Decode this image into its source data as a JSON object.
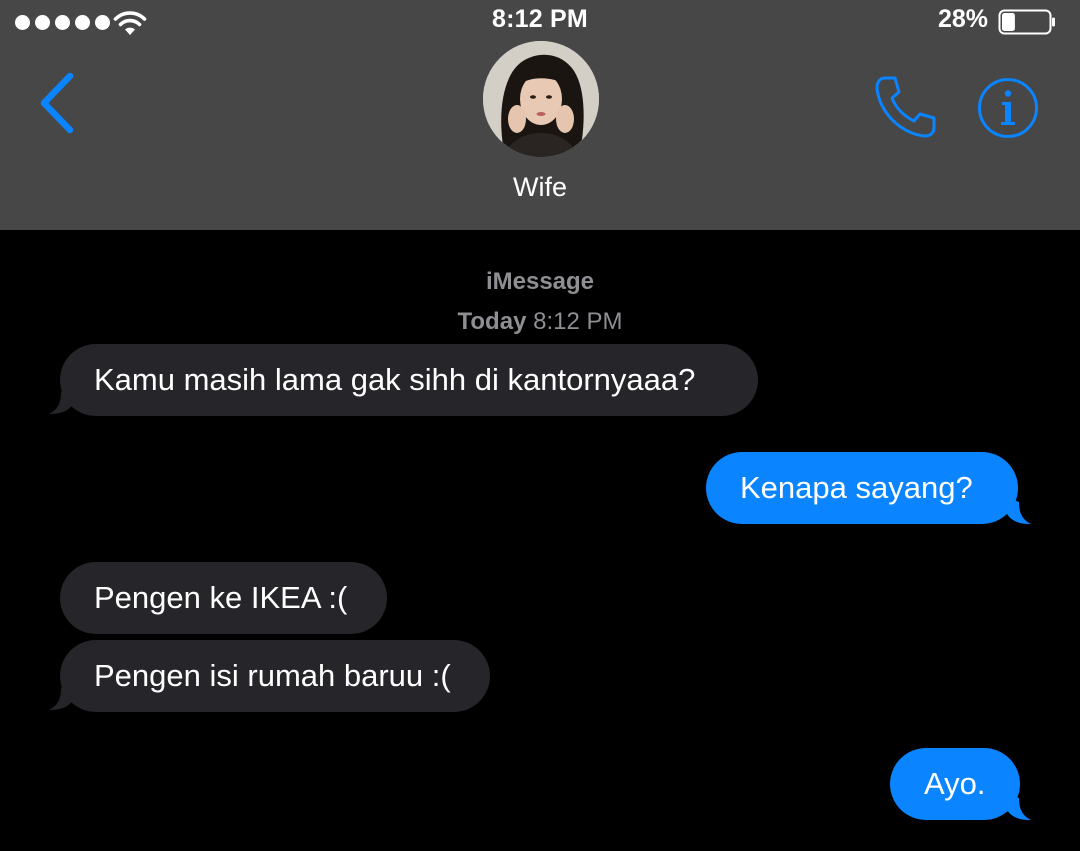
{
  "status_bar": {
    "time": "8:12 PM",
    "battery": "28%",
    "battery_level": 0.28,
    "signal_icon": "signal-dots-icon",
    "wifi_icon": "wifi-icon"
  },
  "nav": {
    "contact_name": "Wife",
    "back_icon": "chevron-left-icon",
    "call_icon": "phone-icon",
    "info_icon": "info-icon",
    "accent_color": "#0a84ff"
  },
  "thread": {
    "service": "iMessage",
    "timestamp_day": "Today",
    "timestamp_time": "8:12 PM",
    "messages": [
      {
        "direction": "incoming",
        "text": "Kamu masih lama gak sihh di kantornyaaa?"
      },
      {
        "direction": "outgoing",
        "text": "Kenapa sayang?"
      },
      {
        "direction": "incoming",
        "text": "Pengen ke IKEA :("
      },
      {
        "direction": "incoming",
        "text": "Pengen isi rumah baruu :("
      },
      {
        "direction": "outgoing",
        "text": "Ayo."
      }
    ]
  },
  "colors": {
    "header_bg": "#474747",
    "background": "#000000",
    "incoming_bubble": "#26252a",
    "outgoing_bubble": "#0a84ff",
    "meta_text": "#8e8e93"
  }
}
